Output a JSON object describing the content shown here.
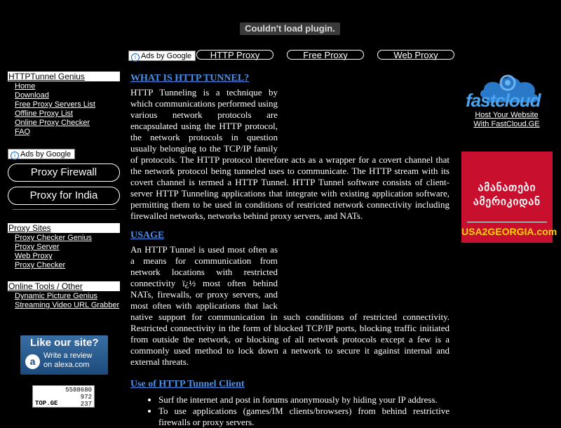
{
  "plugin": {
    "message": "Couldn't load plugin."
  },
  "top_ads": {
    "ads_label": "Ads by Google",
    "links": [
      "HTTP Proxy",
      "Free Proxy",
      "Web Proxy"
    ]
  },
  "sidebar": {
    "section1": {
      "title": "HTTPTunnel Genius",
      "items": [
        "Home",
        "Download",
        "Free Proxy Servers List",
        "Offline Proxy List",
        "Online Proxy Checker",
        "FAQ"
      ]
    },
    "ads_label": "Ads by Google",
    "big_links": [
      "Proxy Firewall",
      "Proxy for India"
    ],
    "section2": {
      "title": "Proxy Sites",
      "items": [
        "Proxy Checker Genius",
        "Proxy Server",
        "Web Proxy",
        "Proxy Checker"
      ]
    },
    "section3": {
      "title": "Online Tools / Other",
      "items": [
        "Dynamic Picture Genius",
        "Streaming Video URL Grabber"
      ]
    },
    "alexa": {
      "headline": "Like our site?",
      "line1": "Write a review",
      "line2": "on alexa.com",
      "badge": "a"
    },
    "topge": {
      "brand": "TOP.GE",
      "counts": [
        "5588680",
        "972",
        "237"
      ]
    }
  },
  "main": {
    "section1": {
      "heading": "WHAT IS HTTP TUNNEL?",
      "text": "HTTP Tunneling is a technique by which communications performed using various network protocols are encapsulated using the HTTP protocol, the network protocols in question usually belonging to the TCP/IP family of protocols. The HTTP protocol therefore acts as a wrapper for a covert channel that the network protocol being tunneled uses to communicate. The HTTP stream with its covert channel is termed a HTTP Tunnel. HTTP Tunnel software consists of client-server HTTP Tunneling applications that integrate with existing application software, permitting them to be used in conditions of restricted network connectivity including firewalled networks, networks behind proxy servers, and NATs."
    },
    "section2": {
      "heading": "USAGE",
      "text": "An HTTP Tunnel is used most often as a means for communication from network locations with restricted connectivity ï¿½ most often behind NATs, firewalls, or proxy servers, and most often with applications that lack native support for communication in such conditions of restricted connectivity. Restricted connectivity in the form of blocked TCP/IP ports, blocking traffic initiated from outside the network, or blocking of all network protocols except a few is a commonly used method to lock down a network to secure it against internal and external threats."
    },
    "section3": {
      "heading": "Use of HTTP Tunnel Client",
      "bullets": [
        "Surf the internet and post in forums anonymously by hiding your IP address.",
        "To use applications (games/IM clients/browsers) from behind restrictive firewalls or proxy servers."
      ]
    }
  },
  "right": {
    "fastcloud": {
      "logo_text": "fastcloud",
      "line1": "Host Your Website",
      "line2": "With FastCloud.GE"
    },
    "usa": {
      "line1": "ამანათები",
      "line2": "ამერიკიდან",
      "site": "USA2GEORGIA.com"
    }
  },
  "colors": {
    "background": "#000000",
    "heading_link": "#4a8fe8",
    "usa_red": "#c8102e"
  }
}
